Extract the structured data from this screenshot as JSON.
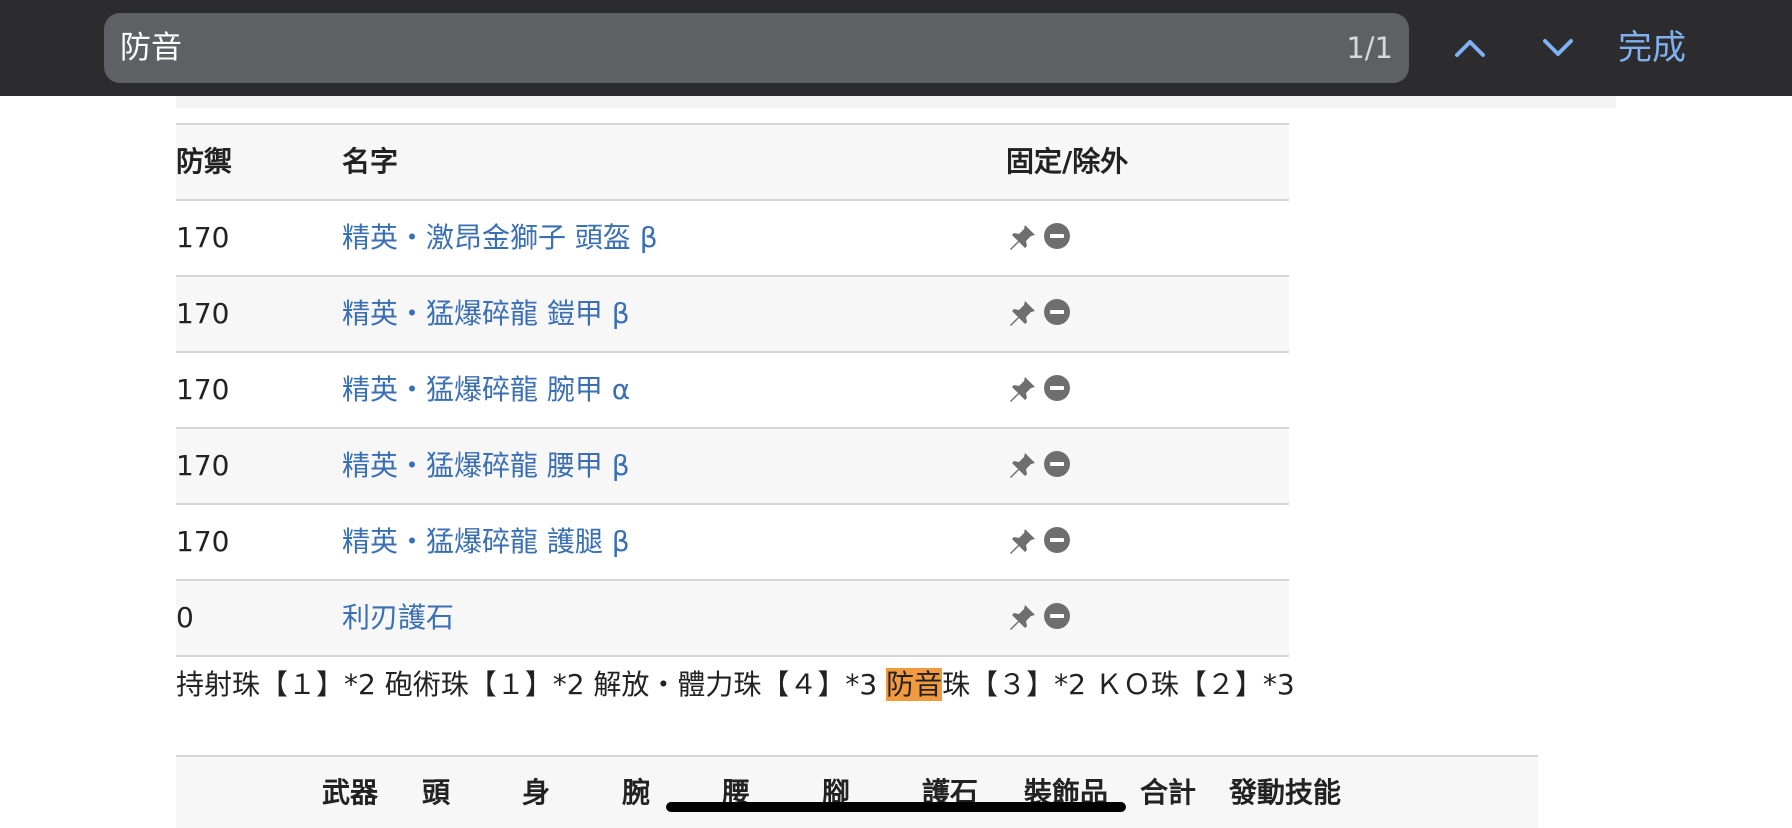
{
  "findbar": {
    "query": "防音",
    "match_count": "1/1",
    "done_label": "完成"
  },
  "equipment_table": {
    "headers": {
      "defense": "防禦",
      "name": "名字",
      "actions": "固定/除外"
    },
    "rows": [
      {
        "defense": "170",
        "name": "精英・激昂金獅子 頭盔 β"
      },
      {
        "defense": "170",
        "name": "精英・猛爆碎龍 鎧甲 β"
      },
      {
        "defense": "170",
        "name": "精英・猛爆碎龍 腕甲 α"
      },
      {
        "defense": "170",
        "name": "精英・猛爆碎龍 腰甲 β"
      },
      {
        "defense": "170",
        "name": "精英・猛爆碎龍 護腿 β"
      },
      {
        "defense": "0",
        "name": "利刃護石"
      }
    ],
    "icons": {
      "fix": "pin-icon",
      "exclude": "minus-circle-icon"
    }
  },
  "decorations": {
    "before": "持射珠【１】*2 砲術珠【１】*2 解放・體力珠【４】*3 ",
    "highlight": "防音",
    "after": "珠【３】*2 ＫＯ珠【２】*3"
  },
  "summary_table": {
    "headers": [
      "武器",
      "頭",
      "身",
      "腕",
      "腰",
      "腳",
      "護石",
      "裝飾品",
      "合計",
      "發動技能"
    ]
  },
  "colors": {
    "findbar_bg": "#2c2c2e",
    "link": "#3a6fb5",
    "highlight": "#f29a3e",
    "done": "#7fb1f0"
  }
}
